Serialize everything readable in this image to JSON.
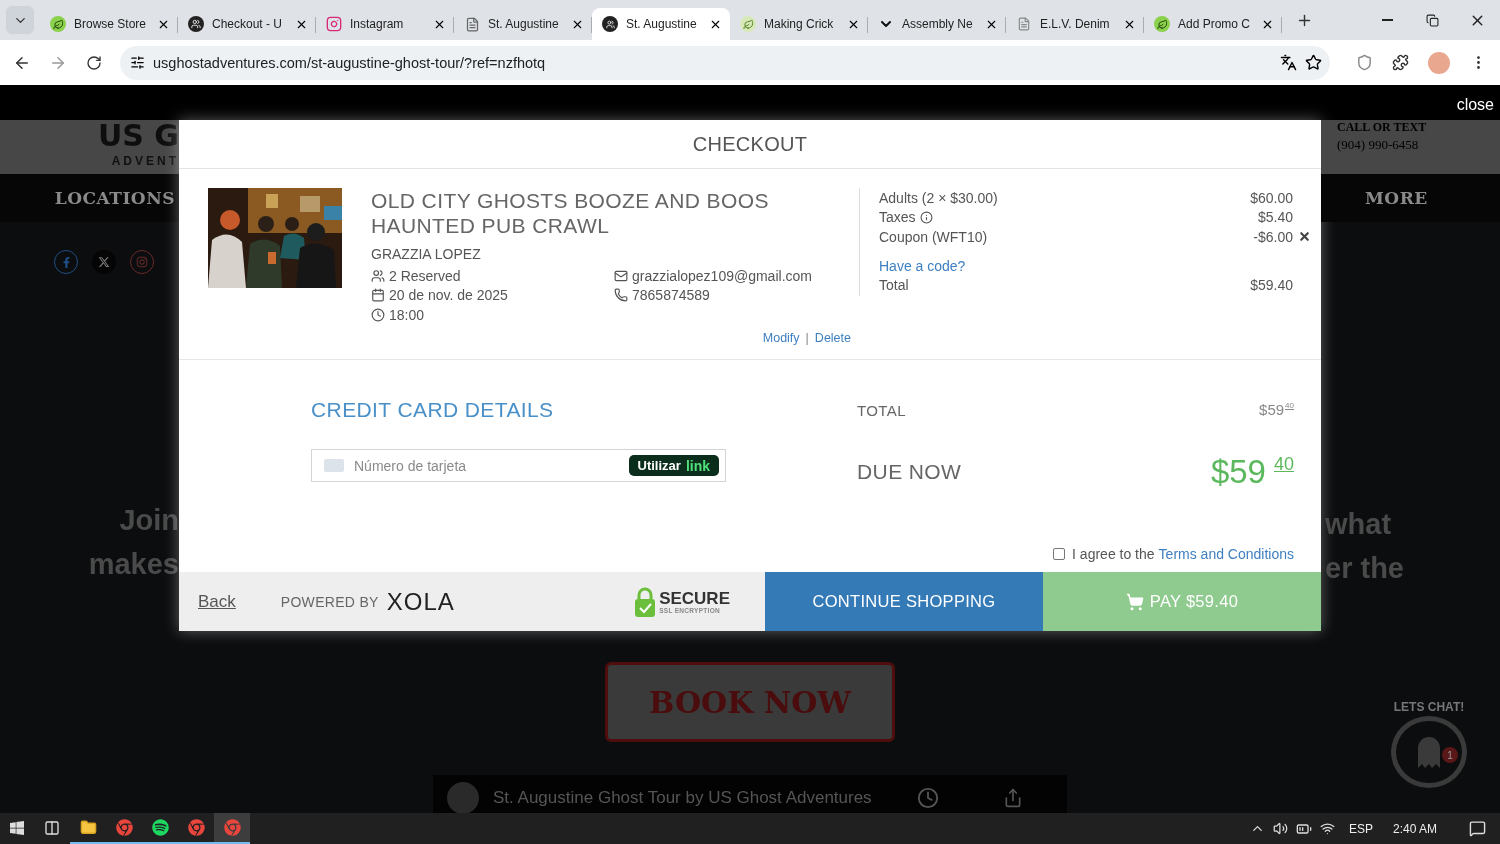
{
  "browser": {
    "tabs": [
      {
        "title": "Browse Store",
        "selected": false
      },
      {
        "title": "Checkout - U",
        "selected": false
      },
      {
        "title": "Instagram",
        "selected": false
      },
      {
        "title": "St. Augustine",
        "selected": false
      },
      {
        "title": "St. Augustine",
        "selected": true
      },
      {
        "title": "Making Crick",
        "selected": false
      },
      {
        "title": "Assembly Ne",
        "selected": false
      },
      {
        "title": "E.L.V. Denim",
        "selected": false
      },
      {
        "title": "Add Promo C",
        "selected": false
      }
    ],
    "url": "usghostadventures.com/st-augustine-ghost-tour/?ref=nzfhotq"
  },
  "site": {
    "close": "close",
    "logo": "US G",
    "logo_sub": "ADVENT",
    "contact_label": "CALL OR TEXT",
    "phone": "(904) 990-6458",
    "nav_left": "LOCATIONS",
    "nav_right": "MORE",
    "left_lines": [
      "Join",
      "makes"
    ],
    "right_lines": [
      "what",
      "er the"
    ],
    "book_button": "BOOK NOW",
    "video_title": "St. Augustine Ghost Tour by US Ghost Adventures",
    "chat_label": "LETS CHAT!",
    "chat_count": "1"
  },
  "checkout": {
    "title": "CHECKOUT",
    "tour": {
      "name": "OLD CITY GHOSTS BOOZE AND BOOS HAUNTED PUB CRAWL",
      "customer": "GRAZZIA LOPEZ",
      "reserved": "2 Reserved",
      "date": "20 de nov. de 2025",
      "time": "18:00",
      "email": "grazzialopez109@gmail.com",
      "phone": "7865874589",
      "actions": [
        "Modify",
        "Delete"
      ],
      "action_separator": "|"
    },
    "summary": [
      {
        "kind": "line",
        "label": "Adults (2 × $30.00)",
        "amount": "$60.00"
      },
      {
        "kind": "info",
        "label": "Taxes",
        "amount": "$5.40"
      },
      {
        "kind": "removable",
        "label": "Coupon (WFT10)",
        "amount": "-$6.00"
      }
    ],
    "code_link": "Have a code?",
    "total": {
      "label": "Total",
      "amount": "$59.40"
    }
  },
  "payment": {
    "heading": "CREDIT CARD DETAILS",
    "total_label": "TOTAL",
    "total_whole": "$59",
    "total_cents": "40",
    "due_label": "DUE NOW",
    "due_whole": "$59",
    "due_cents": "40",
    "card_placeholder": "Número de tarjeta",
    "link_button": {
      "text": "Utilizar",
      "brand": "link"
    },
    "agree": {
      "text": "I agree to the",
      "link": "Terms and Conditions",
      "checked": false
    }
  },
  "footer": {
    "back": "Back",
    "powered_by": "POWERED BY",
    "brand": "XOLA",
    "secure": "SECURE",
    "secure_sub": "SSL ENCRYPTION",
    "continue": "CONTINUE SHOPPING",
    "pay": "PAY $59.40"
  },
  "taskbar": {
    "apps": [
      {
        "selected": false
      },
      {
        "selected": false
      },
      {
        "selected": false
      },
      {
        "selected": false
      },
      {
        "selected": true
      }
    ],
    "lang": "ESP",
    "time": "2:40 AM"
  }
}
